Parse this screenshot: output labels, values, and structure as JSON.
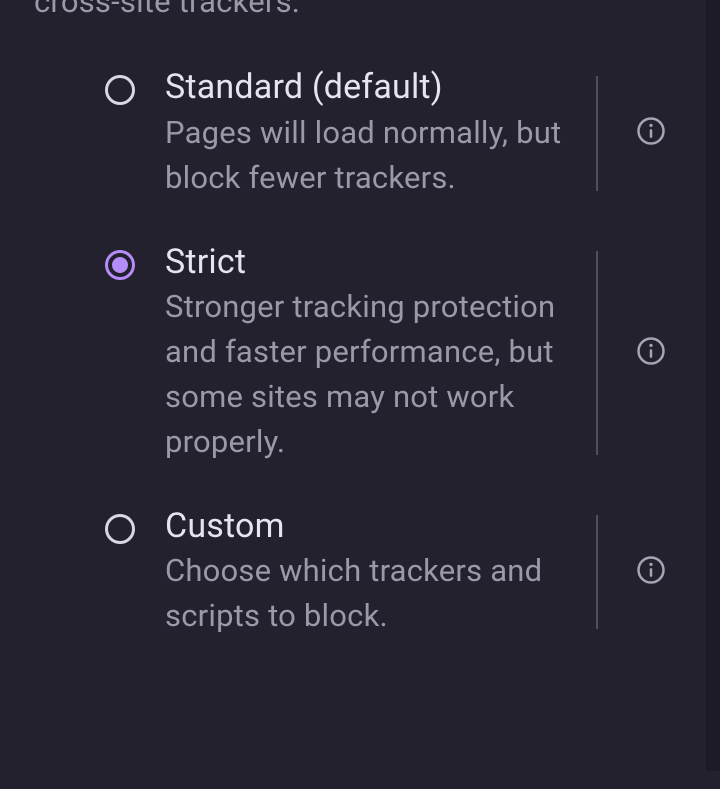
{
  "intro_text": "cross-site trackers.",
  "options": {
    "standard": {
      "title": "Standard (default)",
      "description": "Pages will load normally, but block fewer trackers.",
      "selected": false
    },
    "strict": {
      "title": "Strict",
      "description": "Stronger tracking protection and faster performance, but some sites may not work properly.",
      "selected": true
    },
    "custom": {
      "title": "Custom",
      "description": "Choose which trackers and scripts to block.",
      "selected": false
    }
  }
}
